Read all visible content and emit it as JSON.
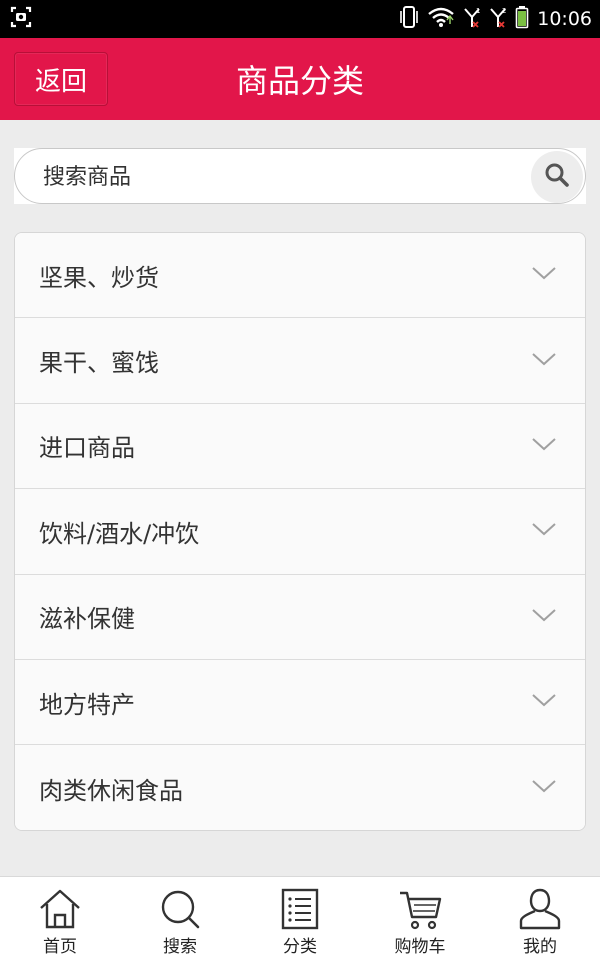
{
  "status_bar": {
    "time": "10:06",
    "icons": [
      "screenshot-icon",
      "vibrate-icon",
      "wifi-icon",
      "signal-1-icon",
      "signal-2-icon",
      "battery-icon"
    ]
  },
  "header": {
    "back_label": "返回",
    "title": "商品分类",
    "color": "#e2164a"
  },
  "search": {
    "placeholder": "搜索商品",
    "button_icon": "search-icon"
  },
  "categories": [
    {
      "label": "坚果、炒货",
      "icon": "chevron-down-icon"
    },
    {
      "label": "果干、蜜饯",
      "icon": "chevron-down-icon"
    },
    {
      "label": "进口商品",
      "icon": "chevron-down-icon"
    },
    {
      "label": "饮料/酒水/冲饮",
      "icon": "chevron-down-icon"
    },
    {
      "label": "滋补保健",
      "icon": "chevron-down-icon"
    },
    {
      "label": "地方特产",
      "icon": "chevron-down-icon"
    },
    {
      "label": "肉类休闲食品",
      "icon": "chevron-down-icon"
    }
  ],
  "bottom_nav": [
    {
      "label": "首页",
      "icon": "home-icon"
    },
    {
      "label": "搜索",
      "icon": "search-icon"
    },
    {
      "label": "分类",
      "icon": "list-icon"
    },
    {
      "label": "购物车",
      "icon": "cart-icon"
    },
    {
      "label": "我的",
      "icon": "user-icon"
    }
  ]
}
